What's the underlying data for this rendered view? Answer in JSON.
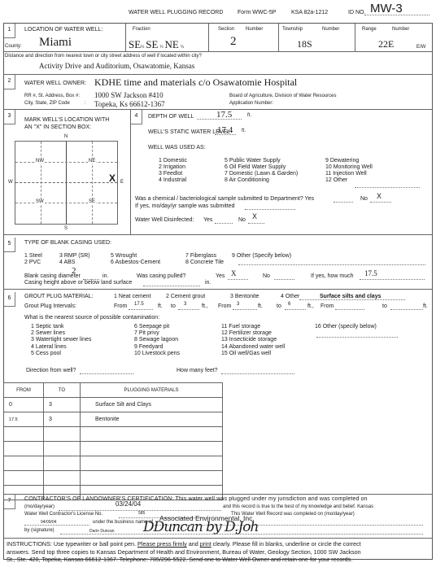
{
  "header": {
    "title": "WATER WELL PLUGGING RECORD",
    "form": "Form WWC-5P",
    "statute": "KSA 82a-1212",
    "id_label": "ID NO.",
    "id_value": "MW-3"
  },
  "section1": {
    "num": "1",
    "label": "LOCATION OF WATER WELL:",
    "county_label": "County:",
    "county": "Miami",
    "fraction_label": "Fraction",
    "fraction": [
      "SE",
      "SE",
      "NE"
    ],
    "quarter_mark": "¼",
    "section_label": "Section",
    "number_label": "Number",
    "section_value": "2",
    "township_label": "Township",
    "township_value": "18S",
    "range_label": "Range",
    "range_value": "22E",
    "ew_label": "E/W",
    "distance_label": "Distance and direction from nearest town or city street address of well if located within city?",
    "distance_value": "Activity Drive and Auditorium, Osawatomie, Kansas"
  },
  "section2": {
    "num": "2",
    "owner_label": "WATER WELL OWNER:",
    "owner_value": "KDHE time and materials c/o Osawatomie Hospital",
    "address_label": "RR #, St. Address, Box #:",
    "address_value": "1000 SW Jackson #410",
    "city_label": "City, State, ZIP Code",
    "city_value": "Topeka, Ks  66612-1367",
    "board_label": "Board of Agriculture, Division of Water Resources",
    "app_label": "Application Number:"
  },
  "section3": {
    "num": "3",
    "label_line1": "MARK WELL'S LOCATION WITH",
    "label_line2": "AN \"X\" IN SECTION BOX:",
    "n": "N",
    "s": "S",
    "e": "E",
    "w": "W",
    "nw": "NW",
    "ne": "NE",
    "sw": "SW",
    "se": "SE",
    "mark": "X"
  },
  "section4": {
    "num": "4",
    "depth_label": "DEPTH OF WELL",
    "depth_value": "17.5",
    "ft": "ft.",
    "static_label": "WELL'S STATIC WATER LEVEL",
    "static_value": "17.4",
    "used_label": "WELL WAS USED AS:",
    "uses": [
      "1 Domestic",
      "2 Irrigation",
      "3 Feedlot",
      "4 Industrial",
      "5 Public Water Supply",
      "6 Oil Field Water Supply",
      "7 Domestic (Lawn & Garden)",
      "8 Air Conditioning",
      "9 Dewatering",
      "10 Monitoring Well",
      "11 Injection Well",
      "12 Other"
    ],
    "sample_q": "Was a chemical / bacteriological sample submitted to Department? Yes",
    "sample_no": "No",
    "sample_mark": "X",
    "sample_date_label": "If yes, mo/day/yr sample was submitted",
    "disinfected_label": "Water Well Disinfected:",
    "disinfected_yes": "Yes",
    "disinfected_no": "No",
    "disinfected_mark": "X"
  },
  "section5": {
    "num": "5",
    "label": "TYPE OF BLANK CASING USED:",
    "types": [
      "1 Steel",
      "2 PVC",
      "3 RMP (SR)",
      "4 ABS",
      "5 Wrought",
      "6 Asbestos-Cement",
      "7 Fiberglass",
      "8 Concrete Tile",
      "9 Other (Specify below)"
    ],
    "diameter_label": "Blank casing diameter",
    "diameter_value": "2",
    "in": "in.",
    "pulled_label": "Was casing pulled?",
    "yes": "Yes",
    "pulled_mark": "X",
    "no": "No",
    "howmuch_label": "If yes, how much",
    "howmuch_value": "17.5",
    "height_label": "Casing height above or below land surface"
  },
  "section6": {
    "num": "6",
    "grout_label": "GROUT PLUG MATERIAL:",
    "grout_options": [
      "1 Neat cement",
      "2 Cement grout",
      "3 Bentonite",
      "4 Other"
    ],
    "grout_other_value": "Surface silts and clays",
    "intervals_label": "Grout Plug Intervals:",
    "from": "From",
    "to": "to",
    "ft": "ft.",
    "intervals": [
      {
        "from": "17.5",
        "to": "3"
      },
      {
        "from": "3",
        "to": "6"
      },
      {
        "from": "",
        "to": ""
      }
    ],
    "contam_label": "What is the nearest source of possible contamination:",
    "contam": [
      "1 Septic tank",
      "2 Sewer lines",
      "3 Watertight sewer lines",
      "4 Lateral lines",
      "5 Cess pool",
      "6 Seepage pit",
      "7 Pit privy",
      "8 Sewage lagoon",
      "9 Feedyard",
      "10 Livestock pens",
      "11 Fuel storage",
      "12 Fertilizer storage",
      "13 Insecticide storage",
      "14 Abandoned water well",
      "15 Oil well/Gas well",
      "16 Other (specify below)"
    ],
    "direction_label": "Direction from well?",
    "feet_label": "How many feet?"
  },
  "plugging_table": {
    "headers": [
      "FROM",
      "TO",
      "PLUGGING MATERIALS"
    ],
    "rows": [
      [
        "0",
        "3",
        "Surface Silt and Clays"
      ],
      [
        "17.5",
        "3",
        "Bentonite"
      ],
      [
        "",
        "",
        ""
      ],
      [
        "",
        "",
        ""
      ],
      [
        "",
        "",
        ""
      ],
      [
        "",
        "",
        ""
      ],
      [
        "",
        "",
        ""
      ]
    ]
  },
  "section7": {
    "num": "7",
    "line1": "CONTRACTOR'S OF LANDOWNER'S CERTIFICATION: This water well was plugged under my jurisdiction and was completed on",
    "line2a": "(mo/day/year)",
    "completed_date": "03/24/04",
    "line2b": "and this record is true to the best of my knowledge and belief. Kansas",
    "line3a": "Water Well Contractor's License No.",
    "license_no": "585",
    "line3b": "This Water Well Record was completed on (mo/day/year)",
    "record_date": "04/09/04",
    "line4a": "under the business name of",
    "business_name": "Associated Environmental, Inc.",
    "line5a": "by (signature)",
    "signer": "Darin Duncan",
    "signature": "DDuncan by D.Joh"
  },
  "instructions": {
    "prefix": "INSTRUCTIONS: Use typewriter or ball point pen. ",
    "u1": "Please press firmly",
    "mid1": " and ",
    "u2": "print",
    "rest1": " clearly. Please fill in blanks, underline or circle the correct",
    "line2": "answers. Send top three copies to Kansas Department of Health and Environment, Bureau of Water, Geology Section, 1000 SW Jackson",
    "line3": "St., Ste. 420, Topeka, Kansas 66612-1367. Telephone: 785/296-5522. Send one to Water Well Owner and retain one for your records."
  }
}
